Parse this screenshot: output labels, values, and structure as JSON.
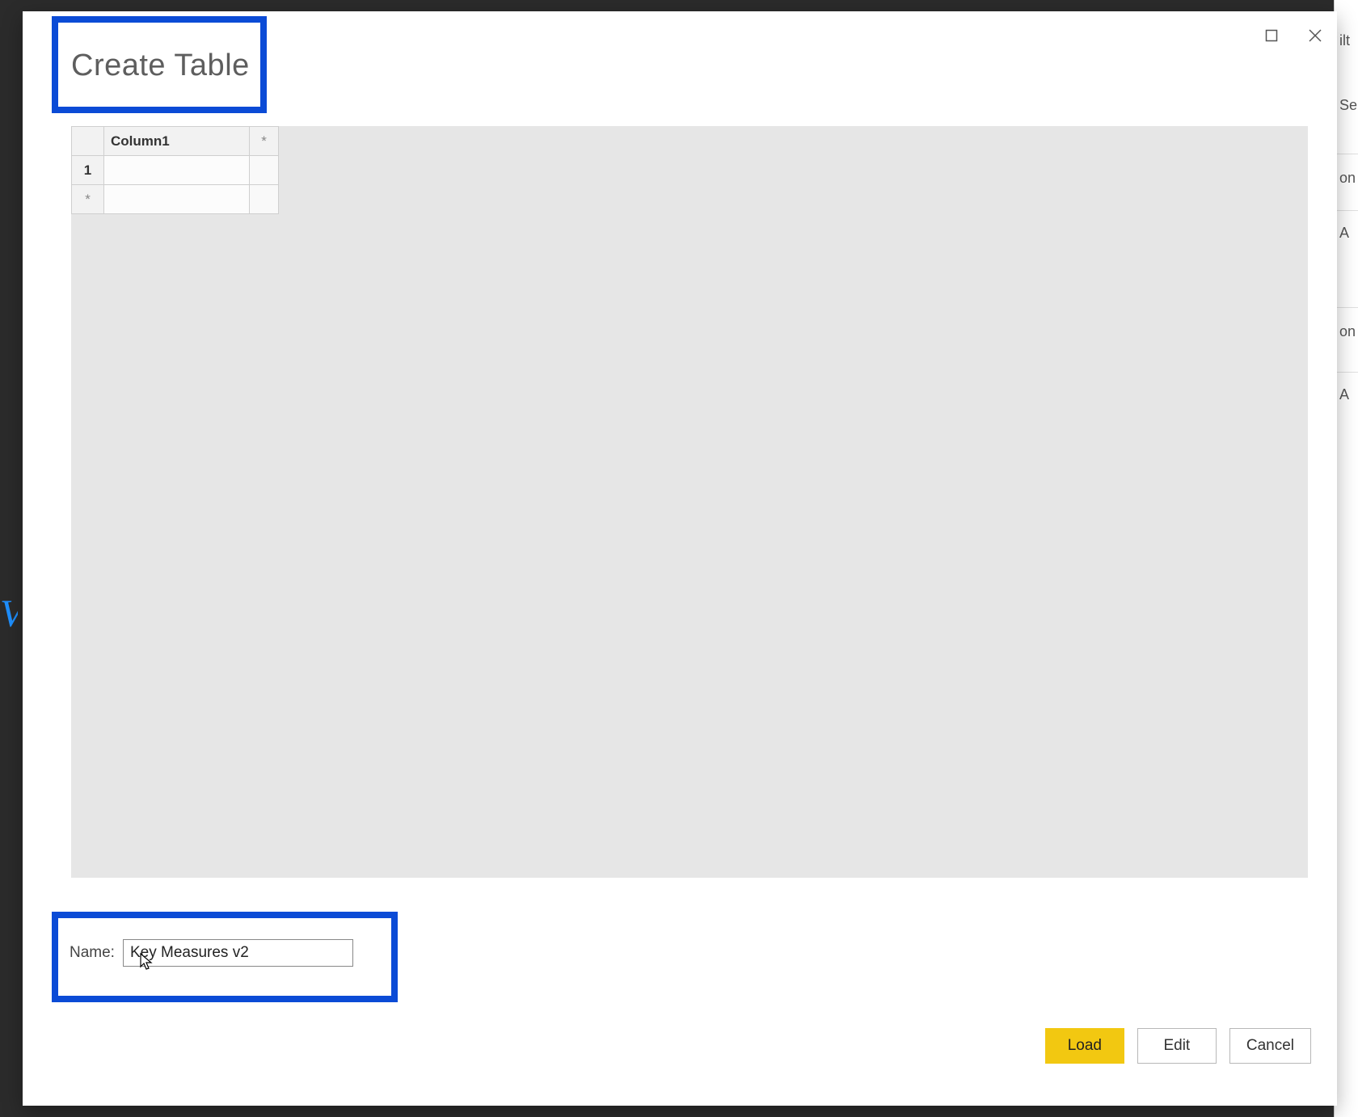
{
  "background": {
    "fragments": [
      "ilt",
      "Se",
      "on",
      "A",
      "on",
      "A"
    ],
    "blue_sliver": "V"
  },
  "dialog": {
    "title": "Create Table",
    "window_controls": {
      "maximize_tooltip": "Maximize",
      "close_tooltip": "Close"
    },
    "grid": {
      "column_headers": [
        "Column1"
      ],
      "add_column_marker": "*",
      "rows": [
        {
          "index": "1",
          "cells": [
            ""
          ]
        }
      ],
      "add_row_marker": "*"
    },
    "name": {
      "label": "Name:",
      "value": "Key Measures v2"
    },
    "buttons": {
      "load": "Load",
      "edit": "Edit",
      "cancel": "Cancel"
    }
  }
}
